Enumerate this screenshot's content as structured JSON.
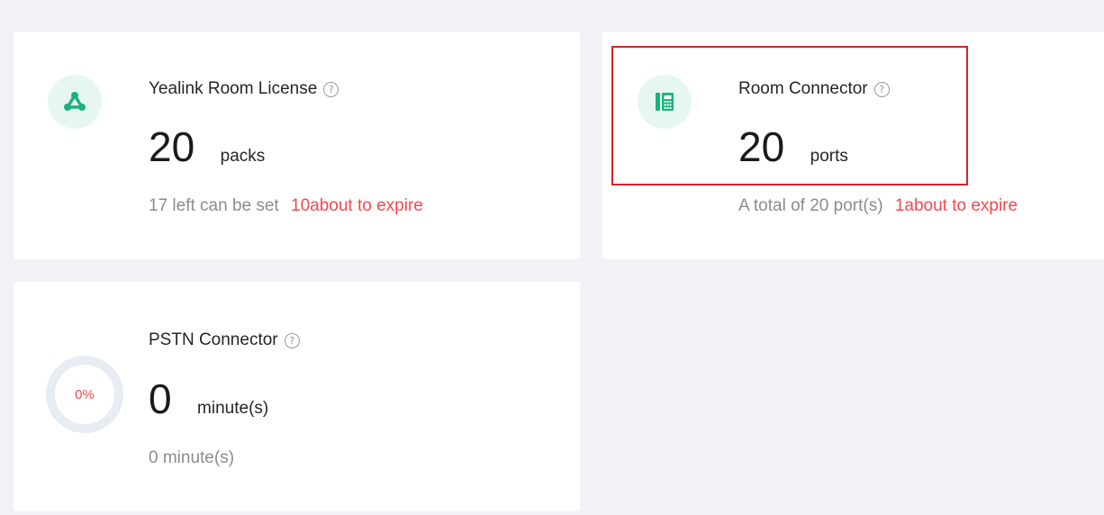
{
  "license": {
    "title": "Yealink Room License",
    "help": "?",
    "value": "20",
    "unit": "packs",
    "sub_text": "17 left can be set",
    "warn_text": "10about to expire"
  },
  "connector": {
    "title": "Room Connector",
    "help": "?",
    "value": "20",
    "unit": "ports",
    "sub_text": "A total of 20 port(s)",
    "warn_text": "1about to expire"
  },
  "pstn": {
    "title": "PSTN Connector",
    "help": "?",
    "value": "0",
    "unit": "minute(s)",
    "sub_text": "0 minute(s)",
    "usage_label": "0%",
    "usage_fraction": 0
  },
  "colors": {
    "accent_green": "#1bb37c",
    "icon_bg": "#e6f7f1",
    "warning_red": "#f5484f",
    "highlight_border": "#d3242e"
  },
  "icons": {
    "license": "network-nodes-icon",
    "connector": "phone-device-icon",
    "help": "question-circle-icon"
  }
}
